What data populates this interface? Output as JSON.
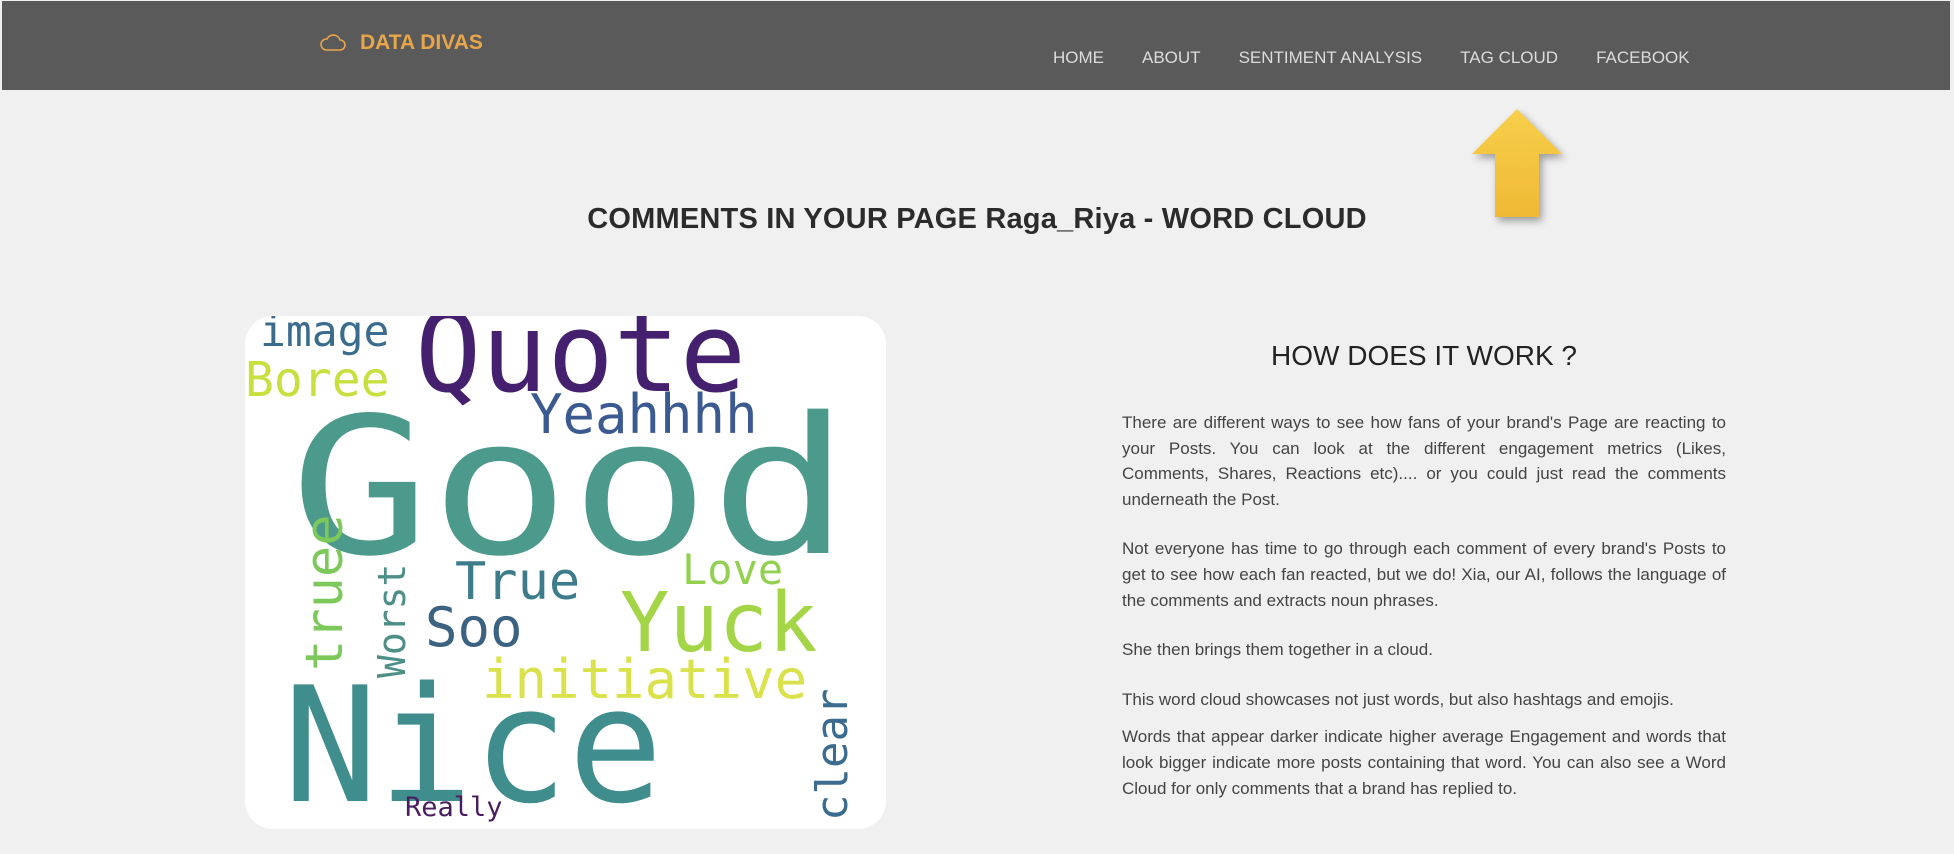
{
  "brand": {
    "name": "DATA DIVAS",
    "icon": "cloud-icon",
    "color": "#e8a64a"
  },
  "nav": {
    "items": [
      "HOME",
      "ABOUT",
      "SENTIMENT ANALYSIS",
      "TAG CLOUD",
      "FACEBOOK"
    ]
  },
  "pointer": {
    "icon": "up-arrow-icon",
    "color": "#f2c53d"
  },
  "page_title": "COMMENTS IN YOUR PAGE Raga_Riya - WORD CLOUD",
  "word_cloud": {
    "words": [
      "image",
      "Quote",
      "Boree",
      "Yeahhhh",
      "Good",
      "Love",
      "True",
      "Worst",
      "Soo",
      "truee",
      "Yuck",
      "initiative",
      "Nice",
      "clear",
      "Really"
    ]
  },
  "info": {
    "heading": "HOW DOES IT WORK ?",
    "paragraphs": [
      "There are different ways to see how fans of your brand's Page are reacting to your Posts. You can look at the different engagement metrics (Likes, Comments, Shares, Reactions etc).... or you could just read the comments underneath the Post.",
      "Not everyone has time to go through each comment of every brand's Posts to get to see how each fan reacted, but we do! Xia, our AI, follows the language of the comments and extracts noun phrases.",
      "She then brings them together in a cloud.",
      "This word cloud showcases not just words, but also hashtags and emojis.",
      "Words that appear darker indicate higher average Engagement and words that look bigger indicate more posts containing that word. You can also see a Word Cloud for only comments that a brand has replied to."
    ]
  }
}
